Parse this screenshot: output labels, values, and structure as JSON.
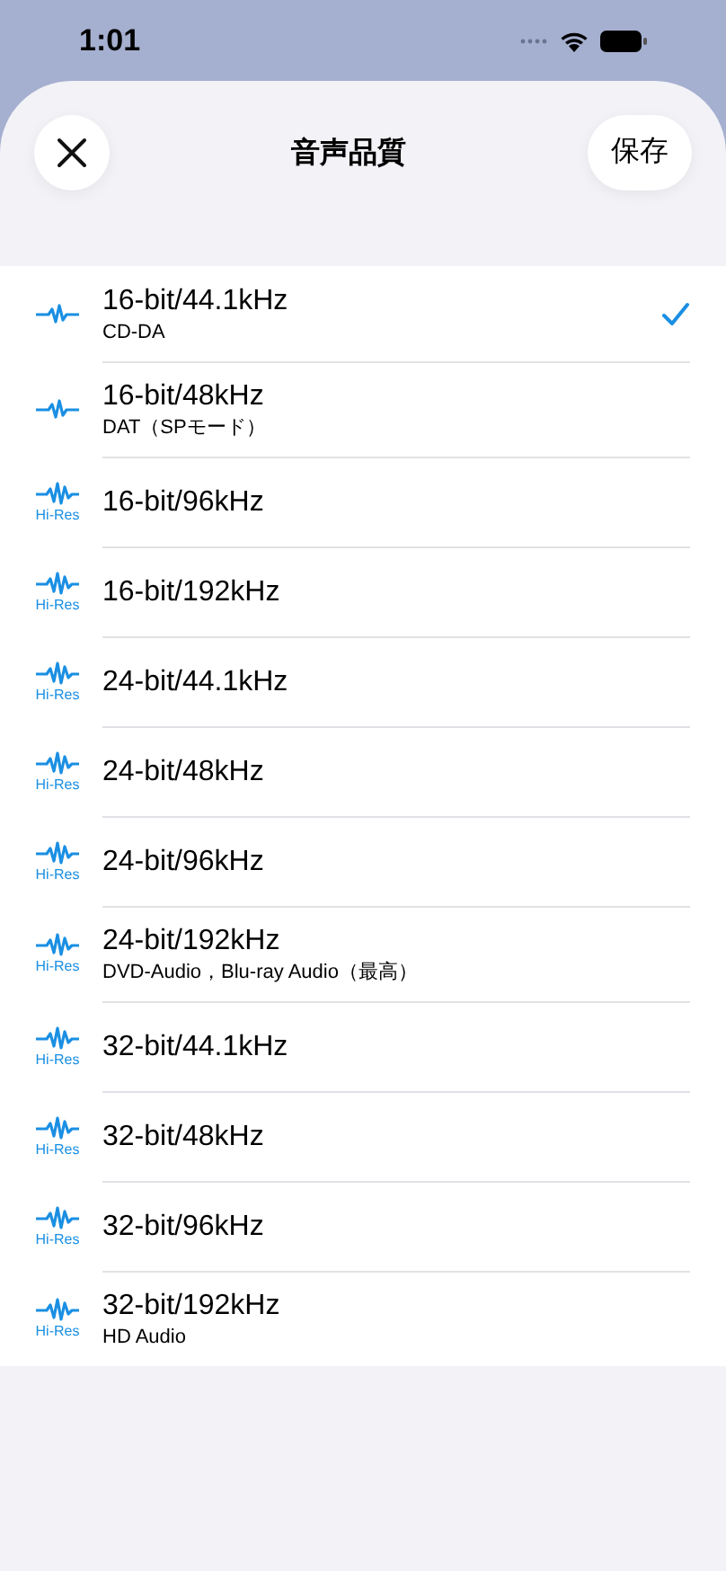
{
  "status_bar": {
    "time": "1:01"
  },
  "header": {
    "title": "音声品質",
    "save": "保存"
  },
  "options": [
    {
      "kind": "standard",
      "title": "16-bit/44.1kHz",
      "subtitle": "CD-DA",
      "selected": true
    },
    {
      "kind": "standard",
      "title": "16-bit/48kHz",
      "subtitle": "DAT（SPモード）",
      "selected": false
    },
    {
      "kind": "hires",
      "badge": "Hi-Res",
      "title": "16-bit/96kHz",
      "selected": false
    },
    {
      "kind": "hires",
      "badge": "Hi-Res",
      "title": "16-bit/192kHz",
      "selected": false
    },
    {
      "kind": "hires",
      "badge": "Hi-Res",
      "title": "24-bit/44.1kHz",
      "selected": false
    },
    {
      "kind": "hires",
      "badge": "Hi-Res",
      "title": "24-bit/48kHz",
      "selected": false
    },
    {
      "kind": "hires",
      "badge": "Hi-Res",
      "title": "24-bit/96kHz",
      "selected": false
    },
    {
      "kind": "hires",
      "badge": "Hi-Res",
      "title": "24-bit/192kHz",
      "subtitle": "DVD-Audio，Blu-ray Audio（最高）",
      "selected": false
    },
    {
      "kind": "hires",
      "badge": "Hi-Res",
      "title": "32-bit/44.1kHz",
      "selected": false
    },
    {
      "kind": "hires",
      "badge": "Hi-Res",
      "title": "32-bit/48kHz",
      "selected": false
    },
    {
      "kind": "hires",
      "badge": "Hi-Res",
      "title": "32-bit/96kHz",
      "selected": false
    },
    {
      "kind": "hires",
      "badge": "Hi-Res",
      "title": "32-bit/192kHz",
      "subtitle": "HD Audio",
      "selected": false
    }
  ]
}
